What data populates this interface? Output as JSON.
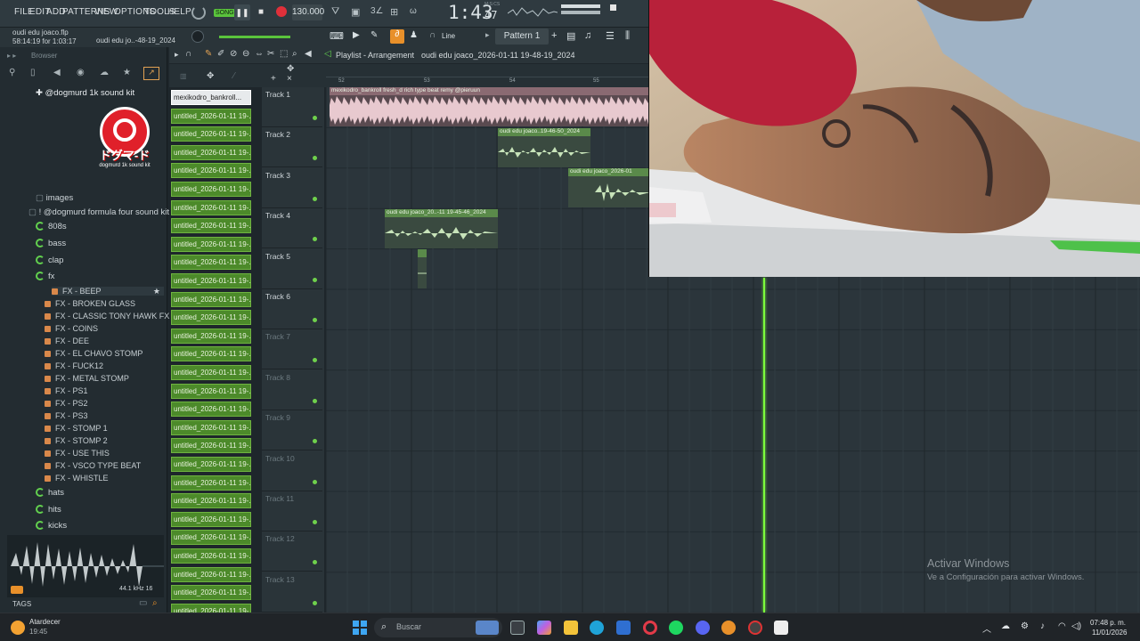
{
  "menu": [
    "FILE",
    "EDIT",
    "ADD",
    "PATTERNS",
    "VIEW",
    "OPTIONS",
    "TOOLS",
    "HELP"
  ],
  "transport": {
    "song_label": "SONG",
    "tempo": "130.000",
    "time": "1:43",
    "time_small": "47",
    "time_unit": "M:S:CS"
  },
  "project": {
    "file": "oudi edu joaco.flp",
    "elapsed": "58:14:19 for 1:03:17",
    "hint": "oudi edu jo..-48-19_2024"
  },
  "toolbar": {
    "snap": "Line",
    "pattern": "Pattern 1"
  },
  "playlist": {
    "title": "Playlist - Arrangement",
    "crumb": "oudi edu joaco_2026-01-11 19-48-19_2024"
  },
  "browser": {
    "header": "Browser",
    "kit_title": "@dogmurd 1k sound kit",
    "logo_caption": "dogmurd 1k sound kit",
    "items": [
      {
        "label": "images",
        "type": "folder-closed"
      },
      {
        "label": "! @dogmurd formula four sound kit",
        "type": "folder-open"
      },
      {
        "label": "808s",
        "type": "rec"
      },
      {
        "label": "bass",
        "type": "rec"
      },
      {
        "label": "clap",
        "type": "rec"
      },
      {
        "label": "fx",
        "type": "rec"
      }
    ],
    "fx": [
      "FX - BEEP",
      "FX - BROKEN GLASS",
      "FX - CLASSIC TONY HAWK FX",
      "FX - COINS",
      "FX - DEE",
      "FX - EL CHAVO STOMP",
      "FX - FUCK12",
      "FX - METAL STOMP",
      "FX - PS1",
      "FX - PS2",
      "FX - PS3",
      "FX - STOMP 1",
      "FX - STOMP 2",
      "FX - USE THIS",
      "FX - VSCO TYPE BEAT",
      "FX - WHISTLE"
    ],
    "after": [
      "hats",
      "hits",
      "kicks"
    ],
    "sample_info": "44.1 kHz 16",
    "tags": "TAGS"
  },
  "channels": [
    "mexikodro_bankroll...",
    "untitled_2026-01-11 19-...",
    "untitled_2026-01-11 19-...",
    "untitled_2026-01-11 19-...",
    "untitled_2026-01-11 19-...",
    "untitled_2026-01-11 19-...",
    "untitled_2026-01-11 19-...",
    "untitled_2026-01-11 19-...",
    "untitled_2026-01-11 19-...",
    "untitled_2026-01-11 19-...",
    "untitled_2026-01-11 19-...",
    "untitled_2026-01-11 19-...",
    "untitled_2026-01-11 19-...",
    "untitled_2026-01-11 19-...",
    "untitled_2026-01-11 19-...",
    "untitled_2026-01-11 19-...",
    "untitled_2026-01-11 19-...",
    "untitled_2026-01-11 19-...",
    "untitled_2026-01-11 19-...",
    "untitled_2026-01-11 19-...",
    "untitled_2026-01-11 19-...",
    "untitled_2026-01-11 19-...",
    "untitled_2026-01-11 19-...",
    "untitled_2026-01-11 19-...",
    "untitled_2026-01-11 19-...",
    "untitled_2026-01-11 19-...",
    "untitled_2026-01-11 19-...",
    "untitled_2026-01-11 19-...",
    "untitled_2026-01-11 19-..."
  ],
  "tracks": [
    "Track 1",
    "Track 2",
    "Track 3",
    "Track 4",
    "Track 5",
    "Track 6",
    "Track 7",
    "Track 8",
    "Track 9",
    "Track 10",
    "Track 11",
    "Track 12",
    "Track 13"
  ],
  "ruler": [
    "52",
    "53",
    "54",
    "55"
  ],
  "clips": [
    "mexikodro_bankroll fresh_d rich type beat remy @pieruun",
    "oudi edu joaco..19-46-50_2024",
    "oudi edu joaco_2026-01",
    "oudi edu joaco_20..-11 19-45-46_2024"
  ],
  "watermark": {
    "line1": "Activar Windows",
    "line2": "Ve a Configuración para activar Windows."
  },
  "taskbar": {
    "weather": "Atardecer",
    "weather_time": "19:45",
    "search": "Buscar",
    "time": "07:48 p. m.",
    "date": "11/01/2026"
  },
  "colors": {
    "accent_green": "#62d04e",
    "clip_green": "#5a8a4a",
    "playhead": "#7cff3c",
    "fx_orange": "#d9884a"
  }
}
